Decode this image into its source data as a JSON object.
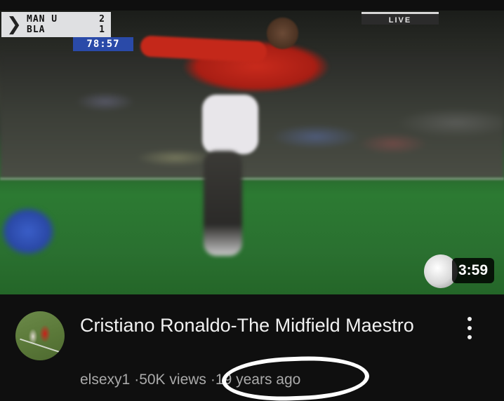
{
  "video": {
    "scoreboard": {
      "home_team": "MAN U",
      "home_score": "2",
      "away_team": "BLA",
      "away_score": "1",
      "clock": "78:57",
      "live_label": "LIVE"
    },
    "duration": "3:59",
    "title": "Cristiano Ronaldo-The Midfield Maestro",
    "channel": "elsexy1",
    "separator": "·",
    "views": "50K views",
    "age": "19 years ago"
  },
  "icons": {
    "more": "more-vert-icon",
    "score_arrow": "chevron-right-icon"
  }
}
